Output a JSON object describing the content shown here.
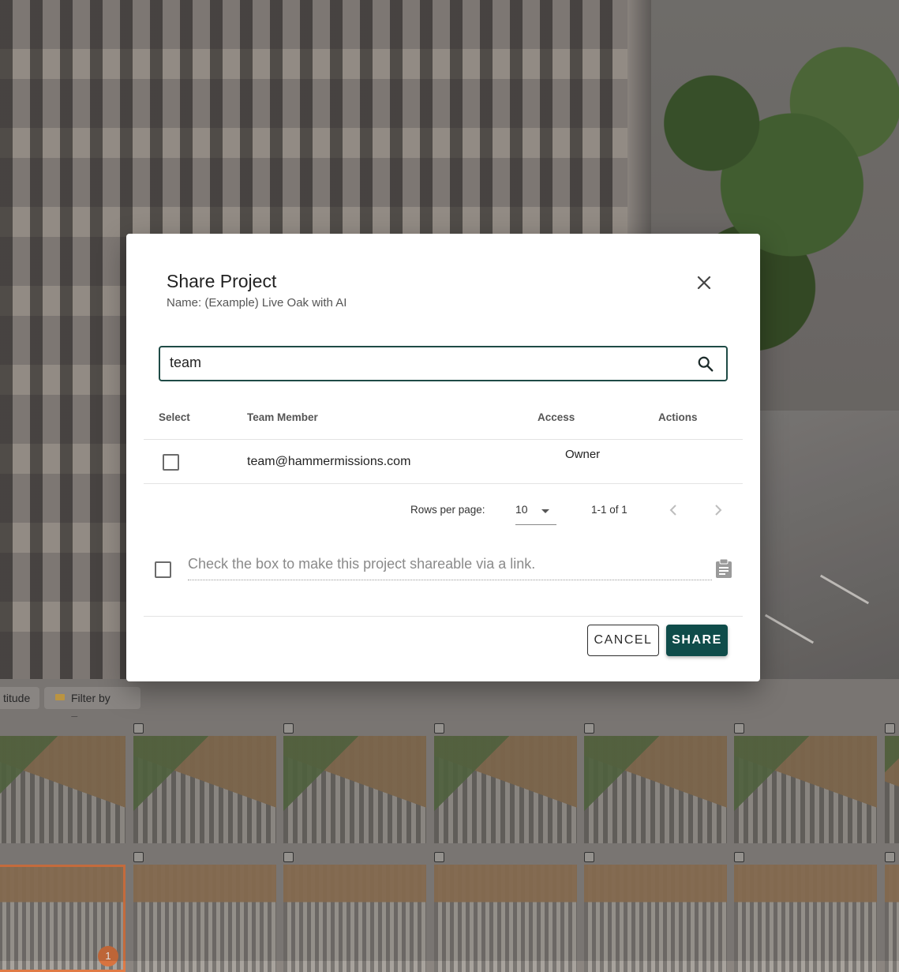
{
  "dialog": {
    "title": "Share Project",
    "subtitle": "Name: (Example) Live Oak with AI",
    "search": {
      "value": "team",
      "placeholder": ""
    },
    "table": {
      "headers": {
        "select": "Select",
        "member": "Team Member",
        "access": "Access",
        "actions": "Actions"
      },
      "rows": [
        {
          "email": "team@hammermissions.com",
          "access": "Owner",
          "selected": false
        }
      ]
    },
    "pagination": {
      "rows_per_page_label": "Rows per page:",
      "rows_per_page_value": "10",
      "range": "1-1 of 1"
    },
    "share_link": {
      "label": "Check the box to make this project shareable via a link.",
      "checked": false
    },
    "buttons": {
      "cancel": "CANCEL",
      "share": "SHARE"
    },
    "colors": {
      "accent": "#0f4c4a",
      "search_border": "#1f4b46"
    }
  },
  "gallery": {
    "toolbar": {
      "altitude_chip": "titude",
      "filter_chip": "Filter by Tag"
    },
    "selected_badge": "1"
  }
}
